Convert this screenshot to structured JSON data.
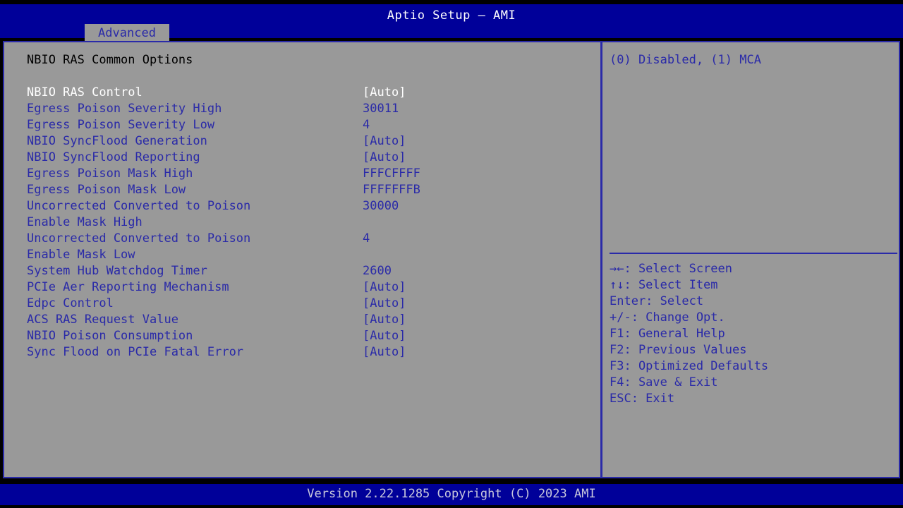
{
  "header": {
    "title": "Aptio Setup – AMI",
    "tabs": [
      {
        "label": "Advanced",
        "active": true
      }
    ]
  },
  "main": {
    "section_title": "NBIO RAS Common Options",
    "rows": [
      {
        "label": "NBIO RAS Control",
        "value": "[Auto]",
        "selected": true
      },
      {
        "label": "Egress Poison Severity High",
        "value": "30011",
        "selected": false
      },
      {
        "label": "Egress Poison Severity Low",
        "value": "4",
        "selected": false
      },
      {
        "label": "NBIO SyncFlood Generation",
        "value": "[Auto]",
        "selected": false
      },
      {
        "label": "NBIO SyncFlood Reporting",
        "value": "[Auto]",
        "selected": false
      },
      {
        "label": "Egress Poison Mask High",
        "value": "FFFCFFFF",
        "selected": false
      },
      {
        "label": "Egress Poison Mask Low",
        "value": "FFFFFFFB",
        "selected": false
      },
      {
        "label": "Uncorrected Converted to Poison",
        "value": "30000",
        "selected": false
      },
      {
        "label": "Enable Mask High",
        "value": "",
        "selected": false
      },
      {
        "label": "Uncorrected Converted to Poison",
        "value": "4",
        "selected": false
      },
      {
        "label": "Enable Mask Low",
        "value": "",
        "selected": false
      },
      {
        "label": "System Hub Watchdog Timer",
        "value": "2600",
        "selected": false
      },
      {
        "label": "PCIe Aer Reporting Mechanism",
        "value": "[Auto]",
        "selected": false
      },
      {
        "label": "Edpc Control",
        "value": "[Auto]",
        "selected": false
      },
      {
        "label": "ACS RAS Request Value",
        "value": "[Auto]",
        "selected": false
      },
      {
        "label": "NBIO Poison Consumption",
        "value": "[Auto]",
        "selected": false
      },
      {
        "label": "Sync Flood on PCIe Fatal Error",
        "value": "[Auto]",
        "selected": false
      }
    ]
  },
  "help": {
    "description": "(0) Disabled, (1) MCA",
    "keys": [
      "→←: Select Screen",
      "↑↓: Select Item",
      "Enter: Select",
      "+/-: Change Opt.",
      "F1: General Help",
      "F2: Previous Values",
      "F3: Optimized Defaults",
      "F4: Save & Exit",
      "ESC: Exit"
    ]
  },
  "footer": {
    "version_text": "Version 2.22.1285 Copyright (C) 2023 AMI"
  },
  "colors": {
    "title_bar": "#000099",
    "panel_bg": "#999999",
    "accent_blue": "#2a2aa8",
    "selected_text": "#ffffff",
    "section_title_text": "#000000",
    "footer_text": "#c8c8dc"
  }
}
